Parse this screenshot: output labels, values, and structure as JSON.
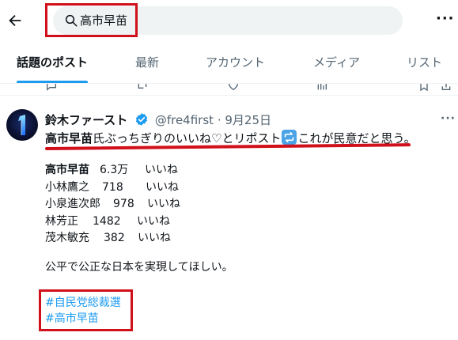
{
  "header": {
    "back_icon": "arrow-left-icon",
    "search_query": "高市早苗",
    "more_label": "···"
  },
  "tabs": [
    {
      "label": "話題のポスト",
      "active": true
    },
    {
      "label": "最新",
      "active": false
    },
    {
      "label": "アカウント",
      "active": false
    },
    {
      "label": "メディア",
      "active": false
    },
    {
      "label": "リスト",
      "active": false
    }
  ],
  "tweet": {
    "author_name": "鈴木ファースト",
    "handle": "@fre4first",
    "separator": "·",
    "date": "9月25日",
    "more_label": "···",
    "line1_bold": "高市早苗",
    "line1_mid": "氏ぶっちぎりのいいね♡とリポスト",
    "line1_end": "これが民意だと思う。",
    "tally": [
      {
        "name": "高市早苗",
        "count": "6.3万",
        "unit": "いいね",
        "bold": true
      },
      {
        "name": "小林鷹之",
        "count": "718",
        "unit": "いいね",
        "bold": false
      },
      {
        "name": "小泉進次郎",
        "count": "978",
        "unit": "いいね",
        "bold": false
      },
      {
        "name": "林芳正",
        "count": "1482",
        "unit": "いいね",
        "bold": false
      },
      {
        "name": "茂木敏充",
        "count": "382",
        "unit": "いいね",
        "bold": false
      }
    ],
    "closing": "公平で公正な日本を実現してほしい。",
    "hashtags": [
      "#自民党総裁選",
      "#高市早苗"
    ]
  },
  "colors": {
    "accent": "#1d9bf0",
    "highlight_red": "#d0101a",
    "secondary_text": "#536471"
  }
}
